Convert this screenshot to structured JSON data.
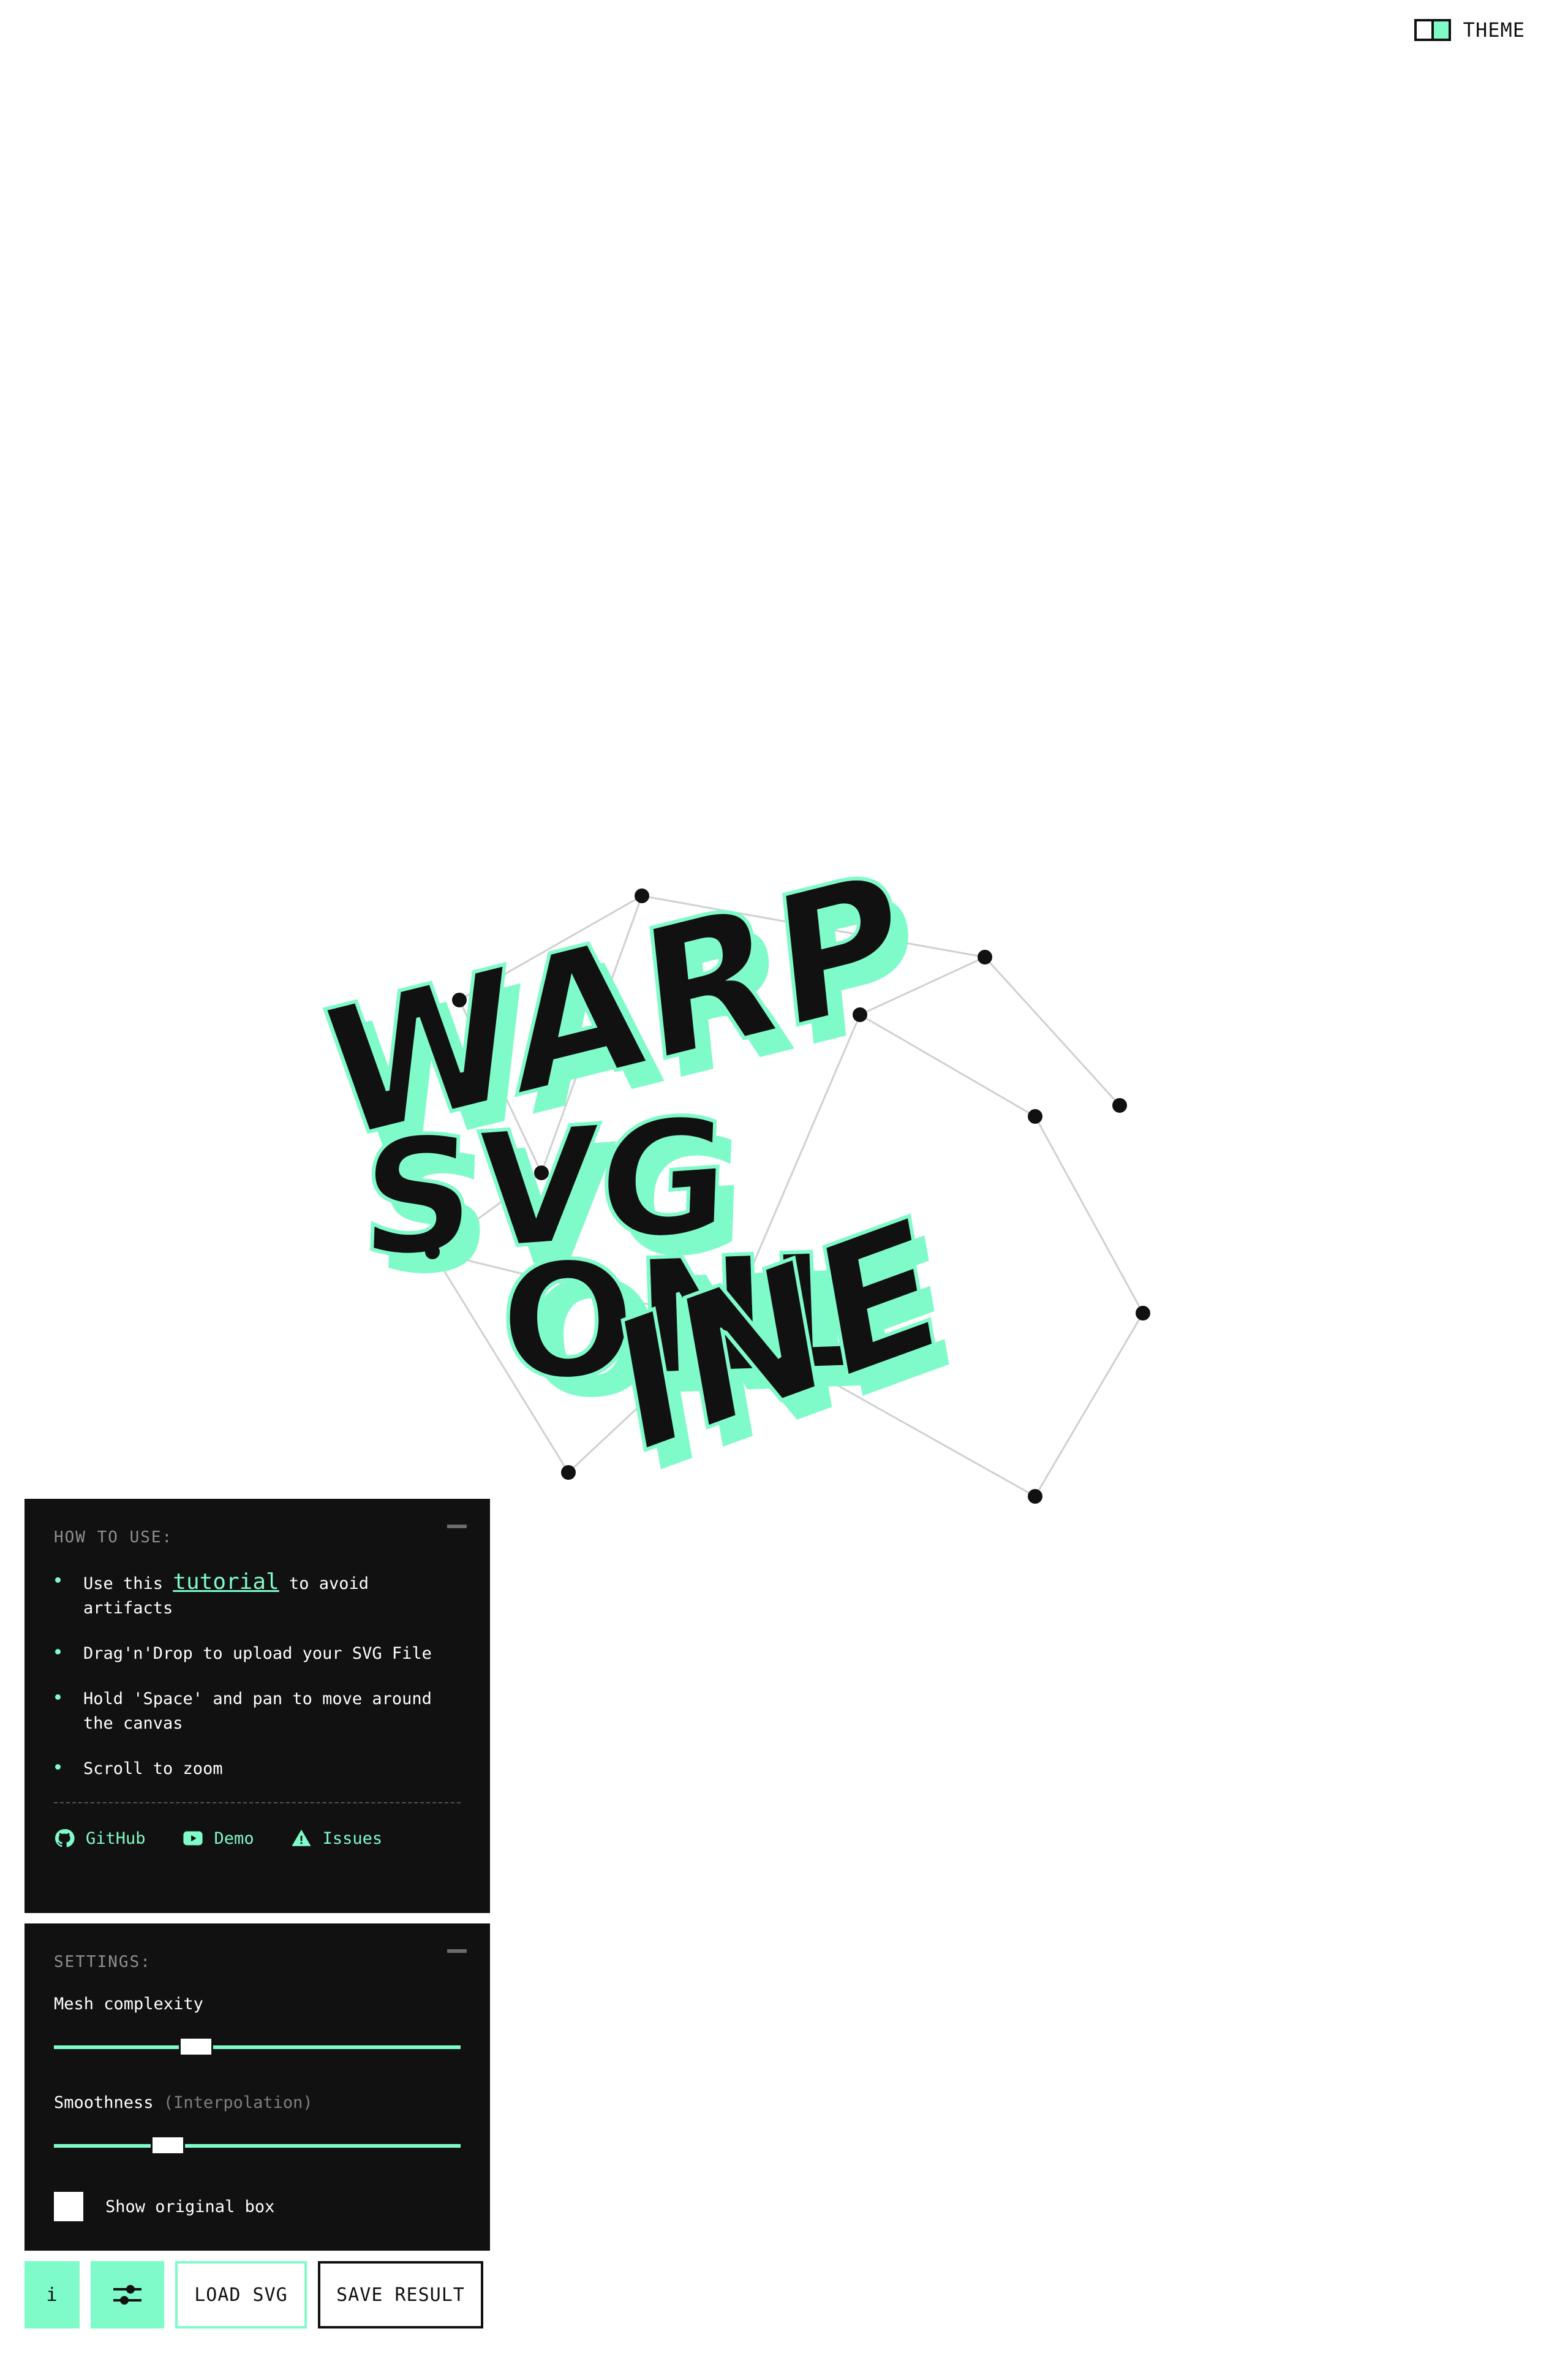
{
  "theme": {
    "label": "THEME"
  },
  "artwork": {
    "lines": [
      "WARP",
      "SVG",
      "ONLINE"
    ]
  },
  "howto": {
    "title": "HOW TO USE:",
    "items": [
      {
        "before": "Use this ",
        "link": "tutorial",
        "after": " to avoid artifacts"
      },
      {
        "text": "Drag'n'Drop to upload your SVG File"
      },
      {
        "text": "Hold 'Space' and pan to move around the canvas"
      },
      {
        "text": "Scroll to zoom"
      }
    ],
    "links": [
      {
        "label": "GitHub",
        "icon": "github-icon"
      },
      {
        "label": "Demo",
        "icon": "play-icon"
      },
      {
        "label": "Issues",
        "icon": "warning-icon"
      }
    ]
  },
  "settings": {
    "title": "SETTINGS:",
    "mesh_label": "Mesh complexity",
    "mesh_value": 0.35,
    "smooth_label": "Smoothness",
    "smooth_hint": "(Interpolation)",
    "smooth_value": 0.28,
    "show_box_label": "Show original box",
    "show_box_checked": false
  },
  "toolbar": {
    "info_label": "i",
    "load_label": "LOAD SVG",
    "save_label": "SAVE RESULT"
  },
  "colors": {
    "accent": "#7ffbc9",
    "panel": "#111111",
    "ink": "#111111"
  }
}
